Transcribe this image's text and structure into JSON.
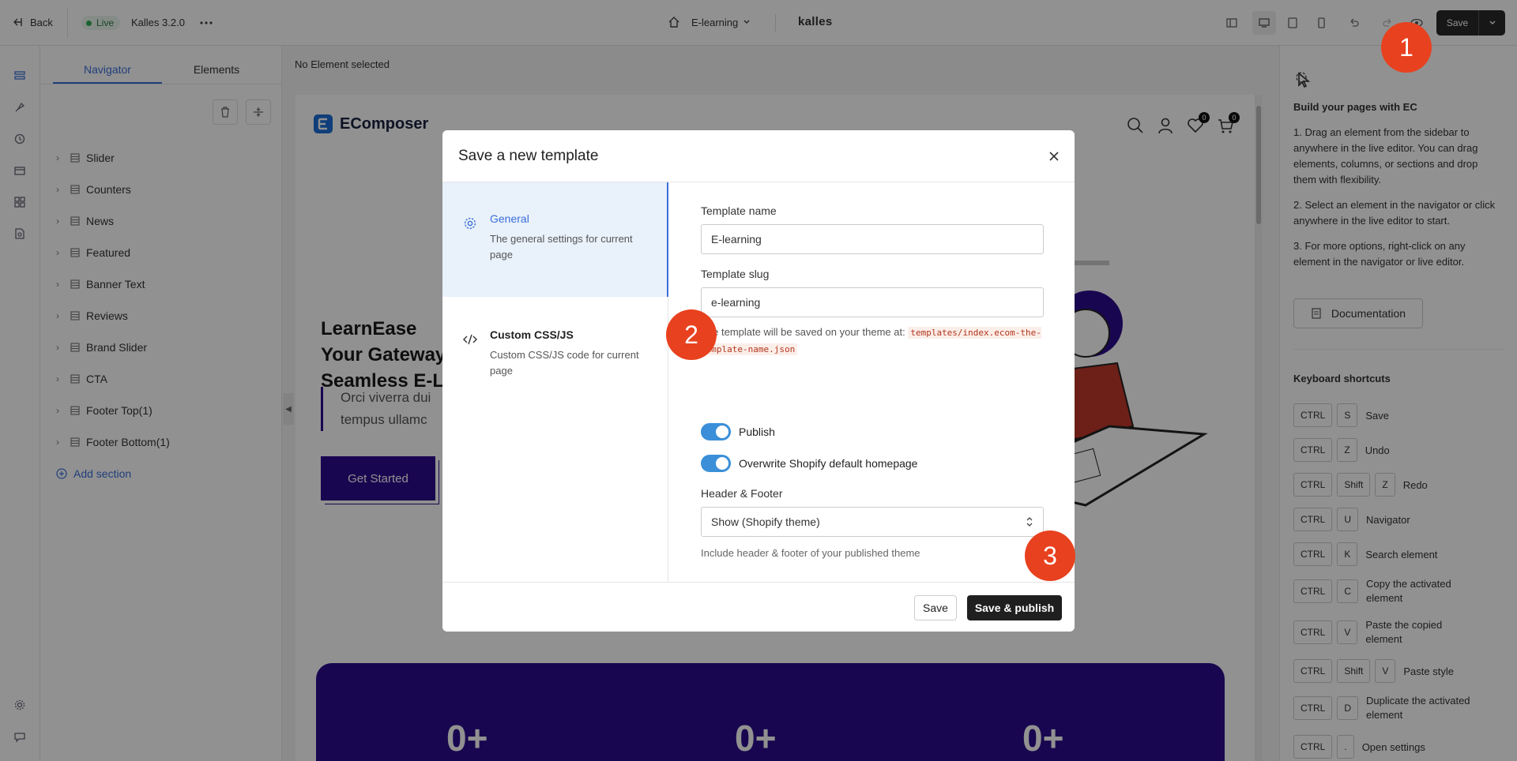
{
  "topbar": {
    "back_label": "Back",
    "live_label": "Live",
    "theme_name": "Kalles 3.2.0",
    "page_select": "E-learning",
    "store_name": "kalles",
    "save_label": "Save"
  },
  "navigator": {
    "tabs": [
      "Navigator",
      "Elements"
    ],
    "items": [
      {
        "label": "Slider"
      },
      {
        "label": "Counters"
      },
      {
        "label": "News"
      },
      {
        "label": "Featured"
      },
      {
        "label": "Banner Text"
      },
      {
        "label": "Reviews"
      },
      {
        "label": "Brand Slider"
      },
      {
        "label": "CTA"
      },
      {
        "label": "Footer Top(1)"
      },
      {
        "label": "Footer Bottom(1)"
      }
    ],
    "add_section": "Add section"
  },
  "canvas": {
    "header_status": "No Element selected",
    "site": {
      "logo_text": "EComposer",
      "cart_count": "0",
      "wishlist_count": "0",
      "hero_lines": [
        "LearnEase",
        "Your Gateway",
        "Seamless E-L"
      ],
      "hero_text_lines": [
        "Orci viverra dui",
        "tempus ullamc"
      ],
      "cta_label": "Get Started",
      "counters": [
        "0+",
        "0+",
        "0+"
      ]
    }
  },
  "right_panel": {
    "title": "Build your pages with EC",
    "tips": [
      "1. Drag an element from the sidebar to anywhere in the live editor. You can drag elements, columns, or sections and drop them with flexibility.",
      "2. Select an element in the navigator or click anywhere in the live editor to start.",
      "3. For more options, right-click on any element in the navigator or live editor."
    ],
    "documentation_label": "Documentation",
    "shortcuts_title": "Keyboard shortcuts",
    "shortcuts": [
      {
        "keys": [
          "CTRL",
          "S"
        ],
        "label": "Save"
      },
      {
        "keys": [
          "CTRL",
          "Z"
        ],
        "label": "Undo"
      },
      {
        "keys": [
          "CTRL",
          "Shift",
          "Z"
        ],
        "label": "Redo"
      },
      {
        "keys": [
          "CTRL",
          "U"
        ],
        "label": "Navigator"
      },
      {
        "keys": [
          "CTRL",
          "K"
        ],
        "label": "Search element"
      },
      {
        "keys": [
          "CTRL",
          "C"
        ],
        "label": "Copy the activated element"
      },
      {
        "keys": [
          "CTRL",
          "V"
        ],
        "label": "Paste the copied element"
      },
      {
        "keys": [
          "CTRL",
          "Shift",
          "V"
        ],
        "label": "Paste style"
      },
      {
        "keys": [
          "CTRL",
          "D"
        ],
        "label": "Duplicate the activated element"
      },
      {
        "keys": [
          "CTRL",
          "."
        ],
        "label": "Open settings"
      }
    ]
  },
  "modal": {
    "title": "Save a new template",
    "sidebar": [
      {
        "title": "General",
        "desc": "The general settings for current page"
      },
      {
        "title": "Custom CSS/JS",
        "desc": "Custom CSS/JS code for current page"
      }
    ],
    "template_name_label": "Template name",
    "template_name_value": "E-learning",
    "template_slug_label": "Template slug",
    "template_slug_value": "e-learning",
    "save_path_prefix": "The template will be saved on your theme at:",
    "save_path_code": "templates/index.ecom-the-template-name.json",
    "publish_label": "Publish",
    "overwrite_label": "Overwrite Shopify default homepage",
    "header_footer_label": "Header & Footer",
    "header_footer_value": "Show (Shopify theme)",
    "header_footer_help": "Include header & footer of your published theme",
    "save_button": "Save",
    "save_publish_button": "Save & publish"
  },
  "annotations": [
    "1",
    "2",
    "3"
  ],
  "colors": {
    "accent": "#3a6fd8",
    "annotation": "#e8411f",
    "brand_purple": "#2c0b8e"
  }
}
